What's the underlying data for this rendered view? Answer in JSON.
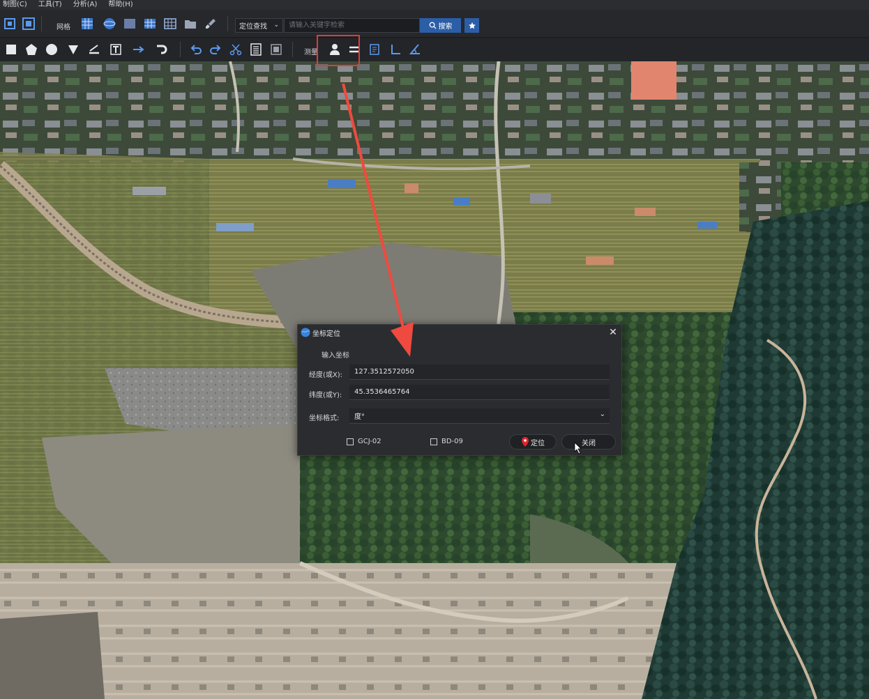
{
  "menubar": {
    "items": [
      "制图(C)",
      "工具(T)",
      "分析(A)",
      "帮助(H)"
    ]
  },
  "toolbar_top": {
    "grid_label": "网格",
    "locate_select": "定位查找",
    "search_placeholder": "请输入关键字检索",
    "search_label": "搜索"
  },
  "toolbar_bottom": {
    "measure_label": "测量"
  },
  "dialog": {
    "title": "坐标定位",
    "section": "输入坐标",
    "lon_label": "经度(或X):",
    "lon_value": "127.3512572050",
    "lat_label": "纬度(或Y):",
    "lat_value": "45.3536465764",
    "format_label": "坐标格式:",
    "format_value": "度°",
    "gcj_label": "GCJ-02",
    "bd_label": "BD-09",
    "locate_button": "定位",
    "close_button": "关闭"
  },
  "colors": {
    "accent": "#2c5ea7",
    "highlight": "#e33b34",
    "pin": "#e3242b"
  }
}
